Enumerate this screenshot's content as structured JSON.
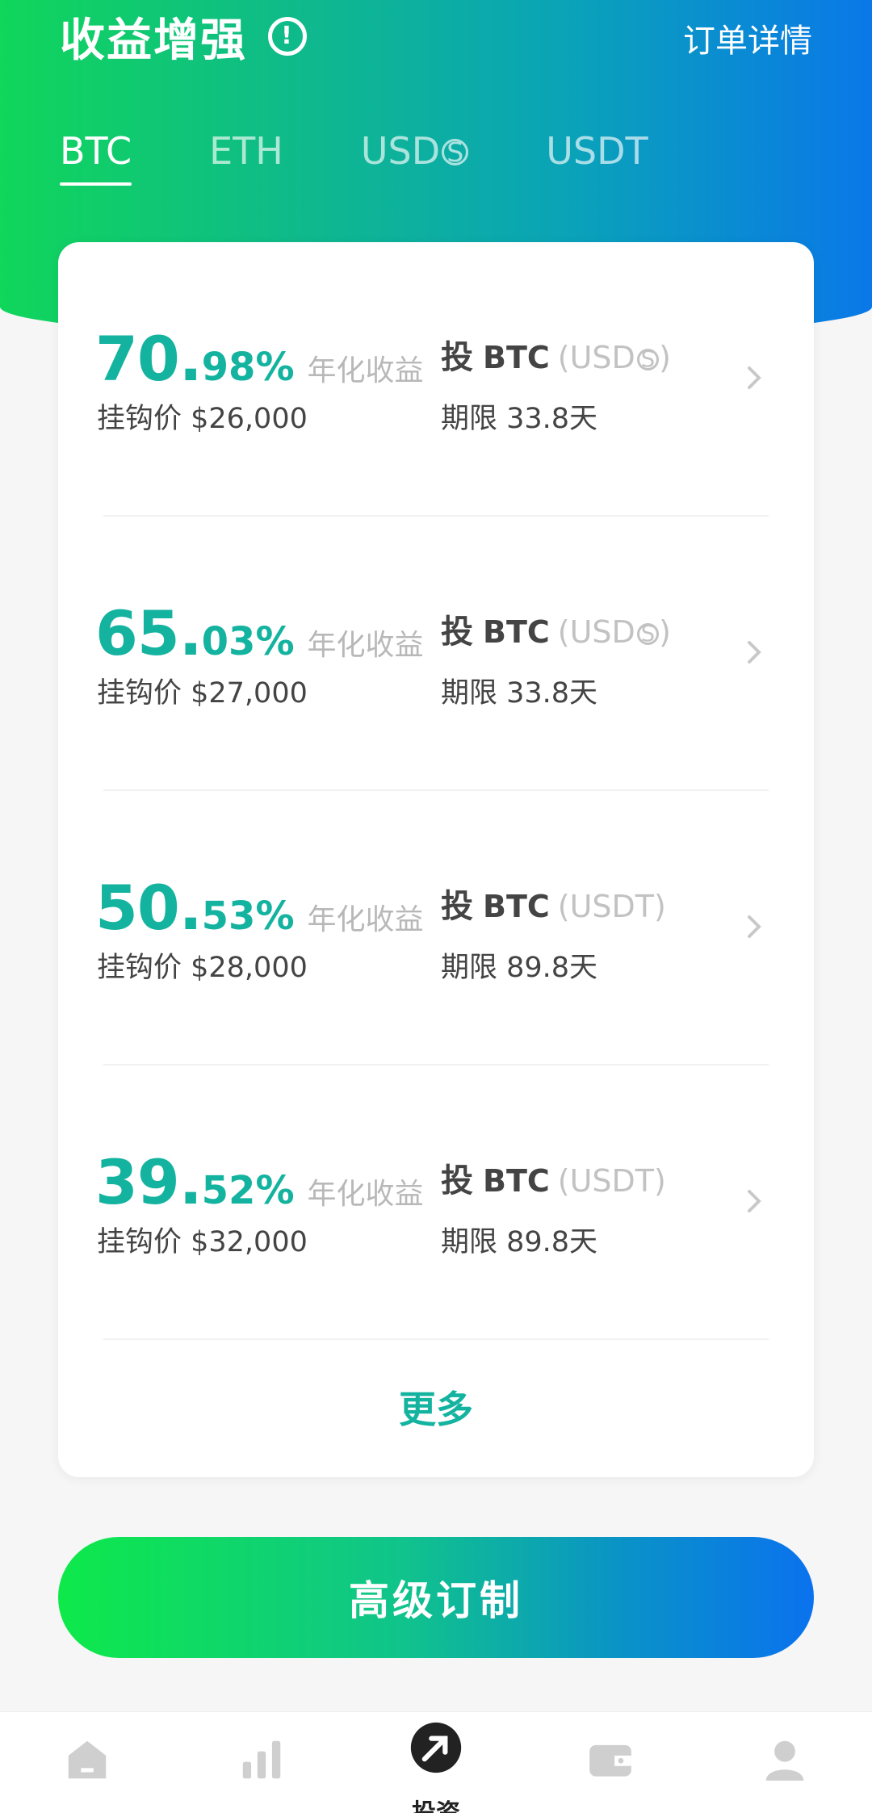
{
  "header": {
    "title": "收益增强",
    "order_details": "订单详情",
    "tabs": [
      {
        "label": "BTC",
        "active": true
      },
      {
        "label": "ETH",
        "active": false
      },
      {
        "label": "USD",
        "suffix": "S",
        "active": false
      },
      {
        "label": "USDT",
        "active": false
      }
    ]
  },
  "products": [
    {
      "rate_int": "70.",
      "rate_dec": "98%",
      "rate_label": "年化收益",
      "strike": "挂钩价 $26,000",
      "invest_prefix": "投",
      "invest_asset": "BTC",
      "invest_quote_open": "(USD",
      "invest_quote_s": "S",
      "invest_quote_close": ")",
      "term": "期限 33.8天"
    },
    {
      "rate_int": "65.",
      "rate_dec": "03%",
      "rate_label": "年化收益",
      "strike": "挂钩价 $27,000",
      "invest_prefix": "投",
      "invest_asset": "BTC",
      "invest_quote_open": "(USD",
      "invest_quote_s": "S",
      "invest_quote_close": ")",
      "term": "期限 33.8天"
    },
    {
      "rate_int": "50.",
      "rate_dec": "53%",
      "rate_label": "年化收益",
      "strike": "挂钩价 $28,000",
      "invest_prefix": "投",
      "invest_asset": "BTC",
      "invest_quote_open": "(USDT)",
      "invest_quote_s": "",
      "invest_quote_close": "",
      "term": "期限 89.8天"
    },
    {
      "rate_int": "39.",
      "rate_dec": "52%",
      "rate_label": "年化收益",
      "strike": "挂钩价 $32,000",
      "invest_prefix": "投",
      "invest_asset": "BTC",
      "invest_quote_open": "(USDT)",
      "invest_quote_s": "",
      "invest_quote_close": "",
      "term": "期限 89.8天"
    }
  ],
  "more_label": "更多",
  "cta_label": "高级订制",
  "nav": {
    "items": [
      {
        "icon": "home-icon"
      },
      {
        "icon": "markets-icon"
      },
      {
        "icon": "invest-icon",
        "label": "投资",
        "active": true
      },
      {
        "icon": "wallet-icon"
      },
      {
        "icon": "profile-icon"
      }
    ]
  },
  "colors": {
    "accent": "#14b3a0",
    "gradient_start": "#10d65a",
    "gradient_end": "#0a78e8"
  }
}
